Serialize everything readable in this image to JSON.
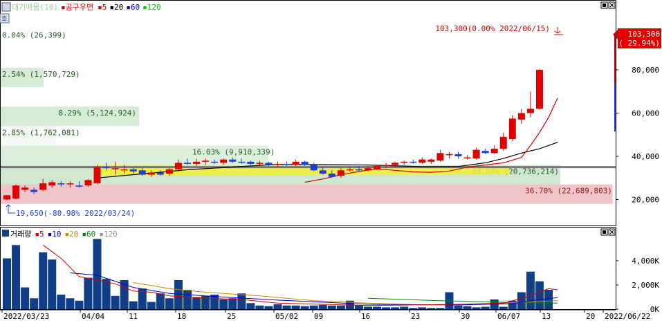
{
  "chart_data": [
    {
      "type": "candlestick",
      "legend": [
        {
          "label": "대기매물(10)",
          "color": "#9bd09b"
        },
        {
          "label": "공구우먼",
          "color": "#d00000"
        },
        {
          "label": "5",
          "color": "#d00000"
        },
        {
          "label": "20",
          "color": "#000000"
        },
        {
          "label": "60",
          "color": "#0000cc"
        },
        {
          "label": "120",
          "color": "#00cc00"
        }
      ],
      "ylim": [
        8000,
        112000
      ],
      "y_ticks": [
        20000,
        40000,
        60000,
        80000
      ],
      "y_tick_labels": [
        "20,000",
        "40,000",
        "60,000",
        "80,000"
      ],
      "price_tag": [
        "103,300",
        "( 29.94%)"
      ],
      "high_annotation": "103,300(0.00% 2022/06/15)",
      "low_annotation": "19,650(-80.98% 2022/03/24)",
      "volume_profile": [
        {
          "lo": 18000,
          "hi": 27000,
          "label": "36.70% (22,689,803)",
          "color": "#f0c4c8"
        },
        {
          "lo": 27000,
          "hi": 36000,
          "label": "33.54% (20,736,214)",
          "color": "#cfe8cf"
        },
        {
          "lo": 36000,
          "hi": 45000,
          "label": "16.03% (9,910,339)",
          "color": "#dcefdc"
        },
        {
          "lo": 45000,
          "hi": 54000,
          "label": "2.85% (1,762,081)",
          "color": "#f5faf5"
        },
        {
          "lo": 54000,
          "hi": 63000,
          "label": "8.29% (5,124,924)",
          "color": "#d6ecd6"
        },
        {
          "lo": 63000,
          "hi": 72000,
          "label": "",
          "color": "#ffffff"
        },
        {
          "lo": 72000,
          "hi": 81000,
          "label": "2.54% (1,570,729)",
          "color": "#d6ecd6"
        },
        {
          "lo": 81000,
          "hi": 90000,
          "label": "",
          "color": "#ffffff"
        },
        {
          "lo": 90000,
          "hi": 99000,
          "label": "0.04% (26,399)",
          "color": "#ffffff"
        }
      ],
      "current_line": 35000,
      "candles": [
        {
          "o": 20000,
          "h": 22000,
          "l": 19650,
          "c": 22000
        },
        {
          "o": 20500,
          "h": 27000,
          "l": 20000,
          "c": 26500
        },
        {
          "o": 24500,
          "h": 26500,
          "l": 23500,
          "c": 25500
        },
        {
          "o": 24500,
          "h": 25500,
          "l": 22500,
          "c": 23500
        },
        {
          "o": 24500,
          "h": 29500,
          "l": 24000,
          "c": 27500
        },
        {
          "o": 26500,
          "h": 29000,
          "l": 25500,
          "c": 28000
        },
        {
          "o": 27500,
          "h": 28500,
          "l": 26000,
          "c": 27000
        },
        {
          "o": 27000,
          "h": 28500,
          "l": 25500,
          "c": 27500
        },
        {
          "o": 26500,
          "h": 28500,
          "l": 25500,
          "c": 26000
        },
        {
          "o": 26500,
          "h": 29500,
          "l": 26000,
          "c": 29000
        },
        {
          "o": 27500,
          "h": 36000,
          "l": 27000,
          "c": 35000
        },
        {
          "o": 35000,
          "h": 37000,
          "l": 33500,
          "c": 34500
        },
        {
          "o": 34000,
          "h": 37500,
          "l": 31500,
          "c": 34500
        },
        {
          "o": 33500,
          "h": 36000,
          "l": 32000,
          "c": 34000
        },
        {
          "o": 34000,
          "h": 35000,
          "l": 32000,
          "c": 33000
        },
        {
          "o": 33500,
          "h": 34500,
          "l": 31000,
          "c": 31500
        },
        {
          "o": 31500,
          "h": 33500,
          "l": 30500,
          "c": 32500
        },
        {
          "o": 32500,
          "h": 33500,
          "l": 31000,
          "c": 31500
        },
        {
          "o": 32000,
          "h": 34500,
          "l": 31000,
          "c": 34000
        },
        {
          "o": 34000,
          "h": 38500,
          "l": 33000,
          "c": 37000
        },
        {
          "o": 37000,
          "h": 39000,
          "l": 36000,
          "c": 36500
        },
        {
          "o": 36500,
          "h": 39000,
          "l": 35500,
          "c": 37500
        },
        {
          "o": 37500,
          "h": 39000,
          "l": 36000,
          "c": 38000
        },
        {
          "o": 37500,
          "h": 38500,
          "l": 36500,
          "c": 37000
        },
        {
          "o": 37000,
          "h": 39000,
          "l": 36000,
          "c": 38500
        },
        {
          "o": 38500,
          "h": 39500,
          "l": 37000,
          "c": 37500
        },
        {
          "o": 37500,
          "h": 39000,
          "l": 36500,
          "c": 37000
        },
        {
          "o": 37500,
          "h": 38000,
          "l": 36000,
          "c": 36500
        },
        {
          "o": 36500,
          "h": 38000,
          "l": 36000,
          "c": 37000
        },
        {
          "o": 37000,
          "h": 37500,
          "l": 35500,
          "c": 36000
        },
        {
          "o": 36000,
          "h": 37500,
          "l": 35000,
          "c": 36500
        },
        {
          "o": 36500,
          "h": 37500,
          "l": 35500,
          "c": 36000
        },
        {
          "o": 36000,
          "h": 38500,
          "l": 35500,
          "c": 37500
        },
        {
          "o": 37500,
          "h": 38000,
          "l": 35500,
          "c": 36000
        },
        {
          "o": 36000,
          "h": 37000,
          "l": 33000,
          "c": 33500
        },
        {
          "o": 33500,
          "h": 35000,
          "l": 31500,
          "c": 32000
        },
        {
          "o": 32000,
          "h": 33500,
          "l": 30000,
          "c": 30500
        },
        {
          "o": 31000,
          "h": 34500,
          "l": 30000,
          "c": 33500
        },
        {
          "o": 33500,
          "h": 35000,
          "l": 33000,
          "c": 34000
        },
        {
          "o": 34000,
          "h": 35500,
          "l": 33000,
          "c": 33500
        },
        {
          "o": 33500,
          "h": 35500,
          "l": 33000,
          "c": 34500
        },
        {
          "o": 34000,
          "h": 36000,
          "l": 33500,
          "c": 35500
        },
        {
          "o": 35500,
          "h": 37000,
          "l": 34500,
          "c": 36000
        },
        {
          "o": 36000,
          "h": 37500,
          "l": 35000,
          "c": 37000
        },
        {
          "o": 37000,
          "h": 38000,
          "l": 36000,
          "c": 37500
        },
        {
          "o": 37500,
          "h": 38500,
          "l": 36500,
          "c": 37000
        },
        {
          "o": 37000,
          "h": 39500,
          "l": 36500,
          "c": 38500
        },
        {
          "o": 37500,
          "h": 39000,
          "l": 36500,
          "c": 38500
        },
        {
          "o": 38000,
          "h": 43000,
          "l": 37500,
          "c": 41500
        },
        {
          "o": 40500,
          "h": 42000,
          "l": 39000,
          "c": 41000
        },
        {
          "o": 41000,
          "h": 42000,
          "l": 39000,
          "c": 40000
        },
        {
          "o": 39500,
          "h": 40500,
          "l": 38500,
          "c": 39500
        },
        {
          "o": 39000,
          "h": 44000,
          "l": 38500,
          "c": 43000
        },
        {
          "o": 42500,
          "h": 43500,
          "l": 41000,
          "c": 41500
        },
        {
          "o": 41500,
          "h": 45000,
          "l": 41000,
          "c": 43500
        },
        {
          "o": 43500,
          "h": 51000,
          "l": 42500,
          "c": 49000
        },
        {
          "o": 48000,
          "h": 59000,
          "l": 47000,
          "c": 57500
        },
        {
          "o": 57000,
          "h": 62000,
          "l": 55000,
          "c": 60000
        },
        {
          "o": 60000,
          "h": 70000,
          "l": 58000,
          "c": 62000
        },
        {
          "o": 62000,
          "h": 80500,
          "l": 61500,
          "c": 80000
        }
      ],
      "ma5": [
        [
          33,
          28000
        ],
        [
          35,
          29500
        ],
        [
          37,
          31500
        ],
        [
          39,
          33000
        ],
        [
          41,
          34200
        ],
        [
          43,
          33500
        ],
        [
          45,
          32800
        ],
        [
          47,
          32600
        ],
        [
          49,
          33200
        ],
        [
          51,
          35000
        ],
        [
          53,
          36000
        ],
        [
          55,
          37000
        ],
        [
          57,
          39500
        ],
        [
          58,
          45000
        ],
        [
          59,
          51000
        ],
        [
          60,
          58000
        ],
        [
          61,
          67000
        ]
      ],
      "ma20": [
        [
          10,
          30000
        ],
        [
          20,
          33800
        ],
        [
          30,
          36300
        ],
        [
          40,
          36000
        ],
        [
          46,
          35200
        ],
        [
          50,
          35300
        ],
        [
          53,
          37000
        ],
        [
          55,
          39000
        ],
        [
          57,
          41500
        ],
        [
          59,
          43500
        ],
        [
          61,
          46500
        ]
      ],
      "x_tick_labels": [
        "2022/03/23",
        "04/04",
        "11",
        "18",
        "25",
        "05/02",
        "09",
        "16",
        "23",
        "30",
        "06/07",
        "13",
        "20",
        "2022/06/22"
      ],
      "volume_title": "거래량",
      "volume_legend": [
        {
          "label": "5",
          "color": "#d00000"
        },
        {
          "label": "10",
          "color": "#0000cc"
        },
        {
          "label": "20",
          "color": "#cc8800"
        },
        {
          "label": "60",
          "color": "#008800"
        },
        {
          "label": "120",
          "color": "#999999"
        }
      ],
      "volume_ylim": [
        0,
        6000000
      ],
      "volume_y_ticks": [
        0,
        2000000,
        4000000
      ],
      "volume_y_tick_labels": [
        "0K",
        "2,000K",
        "4,000K"
      ],
      "volumes": [
        4200000,
        5300000,
        1800000,
        900000,
        4700000,
        4100000,
        1200000,
        900000,
        700000,
        2600000,
        5800000,
        2500000,
        1100000,
        2400000,
        650000,
        1700000,
        600000,
        1300000,
        900000,
        2400000,
        1600000,
        1000000,
        1100000,
        1200000,
        800000,
        900000,
        1300000,
        500000,
        300000,
        250000,
        400000,
        300000,
        300000,
        250000,
        300000,
        350000,
        300000,
        300000,
        700000,
        300000,
        200000,
        200000,
        150000,
        150000,
        200000,
        100000,
        150000,
        100000,
        100000,
        1400000,
        300000,
        250000,
        150000,
        200000,
        800000,
        200000,
        700000,
        1400000,
        3100000,
        2300000,
        1600000
      ],
      "vol_ma5": [
        [
          4,
          5300000
        ],
        [
          6,
          4200000
        ],
        [
          8,
          2700000
        ],
        [
          10,
          2400000
        ],
        [
          12,
          2100000
        ],
        [
          14,
          1500000
        ],
        [
          16,
          1400000
        ],
        [
          18,
          1100000
        ],
        [
          22,
          900000
        ],
        [
          26,
          800000
        ],
        [
          30,
          500000
        ],
        [
          40,
          300000
        ],
        [
          50,
          400000
        ],
        [
          55,
          500000
        ],
        [
          58,
          1100000
        ],
        [
          60,
          1700000
        ],
        [
          61,
          1600000
        ]
      ],
      "vol_ma10": [
        [
          7,
          3000000
        ],
        [
          10,
          2800000
        ],
        [
          14,
          1800000
        ],
        [
          18,
          1300000
        ],
        [
          24,
          1000000
        ],
        [
          30,
          750000
        ],
        [
          40,
          400000
        ],
        [
          50,
          350000
        ],
        [
          56,
          450000
        ],
        [
          59,
          800000
        ],
        [
          61,
          950000
        ]
      ],
      "vol_ma20": [
        [
          14,
          2200000
        ],
        [
          18,
          1700000
        ],
        [
          22,
          1400000
        ],
        [
          28,
          1100000
        ],
        [
          34,
          700000
        ],
        [
          40,
          500000
        ],
        [
          46,
          350000
        ],
        [
          52,
          400000
        ],
        [
          58,
          600000
        ],
        [
          61,
          700000
        ]
      ],
      "vol_ma60": [
        [
          40,
          900000
        ],
        [
          48,
          700000
        ],
        [
          56,
          550000
        ],
        [
          61,
          500000
        ]
      ]
    }
  ]
}
